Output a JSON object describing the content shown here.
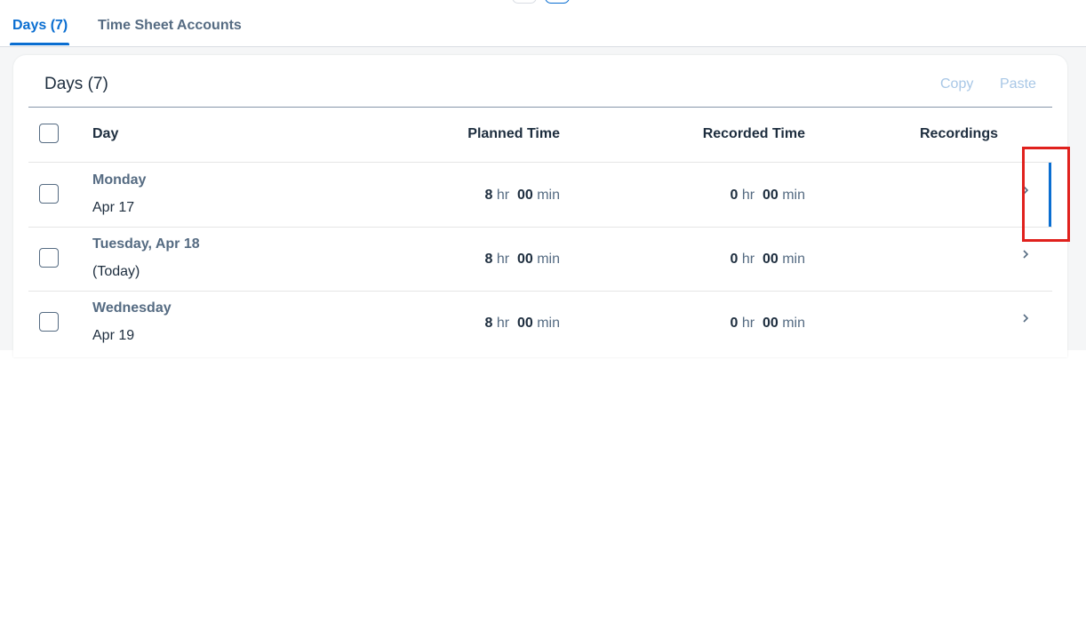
{
  "tabs": {
    "days_label": "Days (7)",
    "accounts_label": "Time Sheet Accounts"
  },
  "card": {
    "title": "Days (7)",
    "copy_label": "Copy",
    "paste_label": "Paste"
  },
  "table": {
    "headers": {
      "day": "Day",
      "planned": "Planned Time",
      "recorded": "Recorded Time",
      "recordings": "Recordings"
    },
    "rows": [
      {
        "day_name": "Monday",
        "day_sub": "Apr 17",
        "planned_hr": "8",
        "planned_min": "00",
        "recorded_hr": "0",
        "recorded_min": "00"
      },
      {
        "day_name": "Tuesday, Apr 18",
        "day_sub": "(Today)",
        "planned_hr": "8",
        "planned_min": "00",
        "recorded_hr": "0",
        "recorded_min": "00"
      },
      {
        "day_name": "Wednesday",
        "day_sub": "Apr 19",
        "planned_hr": "8",
        "planned_min": "00",
        "recorded_hr": "0",
        "recorded_min": "00"
      }
    ],
    "units": {
      "hr": "hr",
      "min": "min"
    }
  },
  "icons": {
    "row_nav": "chevron-right-icon",
    "select": "checkbox"
  },
  "colors": {
    "accent": "#0a6ed1",
    "highlight": "#e0211d",
    "disabled_action": "#a8c7e6",
    "text_primary": "#1d2d3e",
    "text_secondary": "#556b82"
  }
}
